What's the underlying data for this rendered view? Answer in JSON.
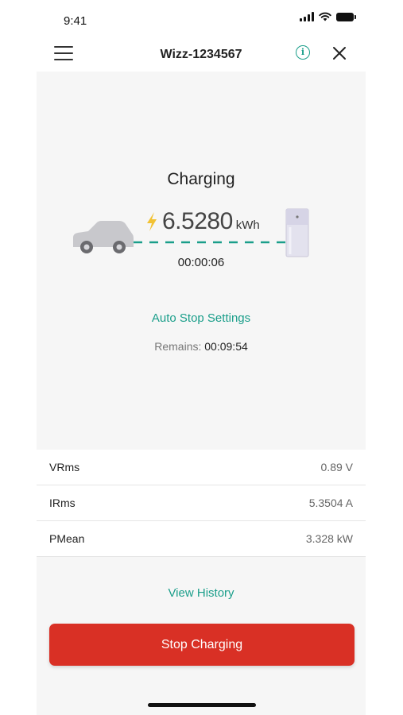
{
  "status_bar": {
    "time": "9:41"
  },
  "nav": {
    "title": "Wizz-1234567",
    "icons": [
      "menu-icon",
      "info-icon",
      "close-icon"
    ],
    "info_glyph": "i"
  },
  "charging": {
    "status": "Charging",
    "energy_value": "6.5280",
    "energy_unit": "kWh",
    "elapsed": "00:00:06",
    "auto_stop_label": "Auto Stop Settings",
    "remains_label": "Remains:",
    "remains_value": "00:09:54"
  },
  "metrics": [
    {
      "name": "VRms",
      "value": "0.89 V"
    },
    {
      "name": "IRms",
      "value": "5.3504 A"
    },
    {
      "name": "PMean",
      "value": "3.328 kW"
    }
  ],
  "actions": {
    "view_history": "View History",
    "stop_button": "Stop Charging"
  },
  "colors": {
    "accent": "#1a9e8a",
    "danger": "#d93025",
    "bolt": "#f2c233",
    "car": "#c8c8cc",
    "panel_bg": "#f6f6f6"
  }
}
